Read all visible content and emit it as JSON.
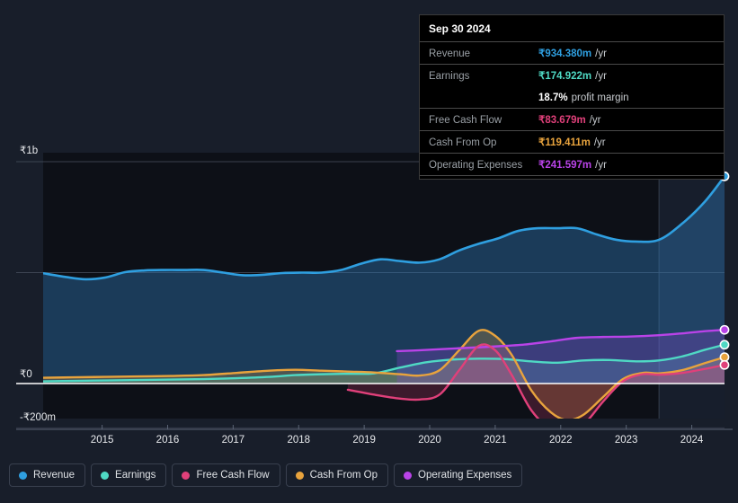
{
  "theme": {
    "background": "#181e2a",
    "plot_background": "#0d1017",
    "forecast_background": "#171e2c",
    "grid_color": "#4a5261",
    "zero_line_color": "#ffffff",
    "axis_text": "#e8eaed"
  },
  "tooltip": {
    "date": "Sep 30 2024",
    "rows": [
      {
        "label": "Revenue",
        "value": "₹934.380m",
        "unit": "/yr",
        "color": "#2f9fe0"
      },
      {
        "label": "Earnings",
        "value": "₹174.922m",
        "unit": "/yr",
        "color": "#4fd9c4"
      },
      {
        "label": "Free Cash Flow",
        "value": "₹83.679m",
        "unit": "/yr",
        "color": "#e0407a"
      },
      {
        "label": "Cash From Op",
        "value": "₹119.411m",
        "unit": "/yr",
        "color": "#e8a33d"
      },
      {
        "label": "Operating Expenses",
        "value": "₹241.597m",
        "unit": "/yr",
        "color": "#b943e8"
      }
    ],
    "profit_margin_value": "18.7%",
    "profit_margin_label": "profit margin"
  },
  "legend": [
    {
      "label": "Revenue",
      "color": "#2f9fe0"
    },
    {
      "label": "Earnings",
      "color": "#4fd9c4"
    },
    {
      "label": "Free Cash Flow",
      "color": "#e0407a"
    },
    {
      "label": "Cash From Op",
      "color": "#e8a33d"
    },
    {
      "label": "Operating Expenses",
      "color": "#b943e8"
    }
  ],
  "axes": {
    "y_ticks": [
      {
        "label": "₹1b",
        "value": 1000
      },
      {
        "label": "₹0",
        "value": 0
      },
      {
        "label": "-₹200m",
        "value": -200
      }
    ],
    "x_ticks": [
      "2015",
      "2016",
      "2017",
      "2018",
      "2019",
      "2020",
      "2021",
      "2022",
      "2023",
      "2024"
    ],
    "ylim": [
      -260,
      1100
    ],
    "unlabeled_gridlines": [
      500
    ]
  },
  "chart_data": {
    "type": "area",
    "title": "",
    "subtitle": "",
    "xlabel": "",
    "ylabel": "",
    "currency": "₹",
    "unit": "m",
    "grid": true,
    "legend_position": "bottom",
    "ylim": [
      -260,
      1100
    ],
    "x_tick_labels": [
      "2015",
      "2016",
      "2017",
      "2018",
      "2019",
      "2020",
      "2021",
      "2022",
      "2023",
      "2024"
    ],
    "x_start": 2014.35,
    "x_end": 2024.75,
    "forecast_boundary_x": 2023.75,
    "series": [
      {
        "name": "Revenue",
        "color": "#2f9fe0",
        "fill": "rgba(47,118,180,0.42)",
        "x": [
          2014.35,
          2014.7,
          2015.0,
          2015.3,
          2015.6,
          2015.9,
          2016.2,
          2016.5,
          2016.8,
          2017.1,
          2017.4,
          2017.7,
          2018.0,
          2018.3,
          2018.6,
          2018.9,
          2019.2,
          2019.5,
          2019.8,
          2020.1,
          2020.4,
          2020.7,
          2021.0,
          2021.3,
          2021.6,
          2021.9,
          2022.2,
          2022.5,
          2022.8,
          2023.1,
          2023.4,
          2023.75,
          2024.1,
          2024.45,
          2024.75
        ],
        "values": [
          497,
          480,
          470,
          478,
          502,
          510,
          512,
          512,
          512,
          500,
          488,
          490,
          498,
          500,
          500,
          512,
          540,
          560,
          552,
          545,
          560,
          600,
          630,
          655,
          688,
          700,
          700,
          700,
          672,
          648,
          640,
          648,
          720,
          820,
          934
        ]
      },
      {
        "name": "Earnings",
        "color": "#4fd9c4",
        "fill": "rgba(79,217,196,0.22)",
        "x": [
          2014.35,
          2014.8,
          2015.3,
          2015.8,
          2016.3,
          2016.8,
          2017.3,
          2017.8,
          2018.2,
          2018.6,
          2019.0,
          2019.4,
          2019.8,
          2020.2,
          2020.6,
          2021.0,
          2021.4,
          2021.8,
          2022.2,
          2022.6,
          2023.0,
          2023.4,
          2023.75,
          2024.1,
          2024.45,
          2024.75
        ],
        "values": [
          10,
          12,
          14,
          16,
          18,
          20,
          24,
          30,
          38,
          42,
          44,
          46,
          72,
          96,
          108,
          112,
          110,
          100,
          94,
          104,
          106,
          100,
          104,
          122,
          152,
          175
        ]
      },
      {
        "name": "Free Cash Flow",
        "color": "#e0407a",
        "fill": "rgba(224,64,122,0.22)",
        "x": [
          2019.0,
          2019.4,
          2019.8,
          2020.1,
          2020.4,
          2020.7,
          2021.0,
          2021.25,
          2021.5,
          2021.8,
          2022.1,
          2022.35,
          2022.6,
          2022.9,
          2023.2,
          2023.5,
          2023.75,
          2024.1,
          2024.45,
          2024.75
        ],
        "values": [
          -28,
          -50,
          -68,
          -72,
          -50,
          60,
          170,
          150,
          40,
          -120,
          -205,
          -215,
          -185,
          -80,
          10,
          42,
          40,
          48,
          66,
          84
        ]
      },
      {
        "name": "Cash From Op",
        "color": "#e8a33d",
        "fill": "rgba(232,163,61,0.25)",
        "x": [
          2014.35,
          2014.8,
          2015.3,
          2015.8,
          2016.3,
          2016.8,
          2017.3,
          2017.8,
          2018.2,
          2018.6,
          2019.0,
          2019.4,
          2019.8,
          2020.1,
          2020.4,
          2020.7,
          2021.0,
          2021.25,
          2021.5,
          2021.8,
          2022.1,
          2022.35,
          2022.6,
          2022.9,
          2023.2,
          2023.5,
          2023.75,
          2024.1,
          2024.45,
          2024.75
        ],
        "values": [
          26,
          28,
          30,
          32,
          34,
          38,
          48,
          58,
          62,
          58,
          54,
          50,
          42,
          36,
          60,
          150,
          238,
          215,
          130,
          -30,
          -130,
          -165,
          -140,
          -60,
          20,
          48,
          46,
          60,
          92,
          119
        ]
      },
      {
        "name": "Operating Expenses",
        "color": "#b943e8",
        "fill": "rgba(148,67,216,0.28)",
        "x": [
          2019.75,
          2020.1,
          2020.5,
          2020.9,
          2021.3,
          2021.7,
          2022.1,
          2022.5,
          2022.9,
          2023.3,
          2023.75,
          2024.1,
          2024.45,
          2024.75
        ],
        "values": [
          146,
          150,
          156,
          162,
          168,
          176,
          190,
          206,
          210,
          212,
          218,
          226,
          236,
          242
        ]
      }
    ]
  }
}
